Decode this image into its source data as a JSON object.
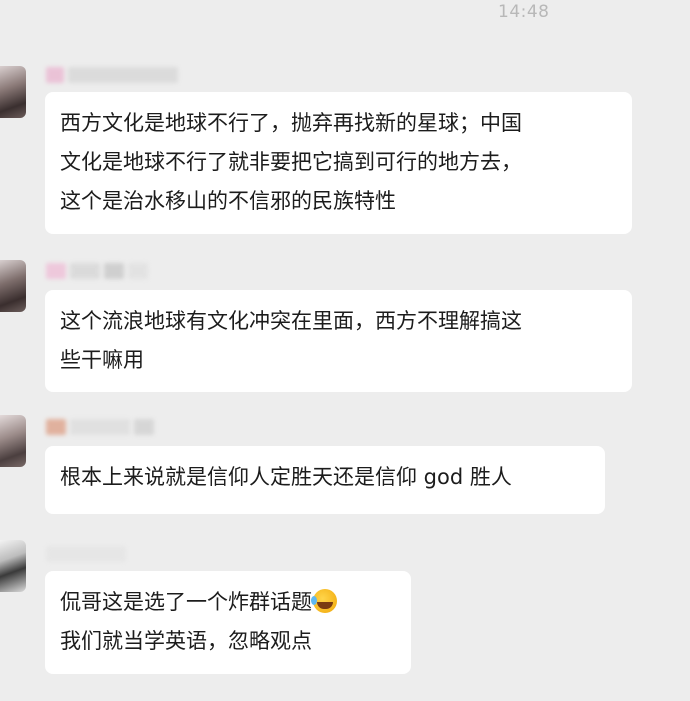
{
  "chat": {
    "timestamp": "14:48",
    "messages": [
      {
        "lines": [
          "西方文化是地球不行了，抛弃再找新的星球；中国",
          "文化是地球不行了就非要把它搞到可行的地方去，",
          "这个是治水移山的不信邪的民族特性"
        ]
      },
      {
        "lines": [
          "这个流浪地球有文化冲突在里面，西方不理解搞这",
          "些干嘛用"
        ]
      },
      {
        "lines": [
          "根本上来说就是信仰人定胜天还是信仰 god 胜人"
        ]
      },
      {
        "lines": [
          "侃哥这是选了一个炸群话题",
          "我们就当学英语，忽略观点"
        ],
        "emoji": "rolling-on-floor-laughing"
      }
    ]
  }
}
